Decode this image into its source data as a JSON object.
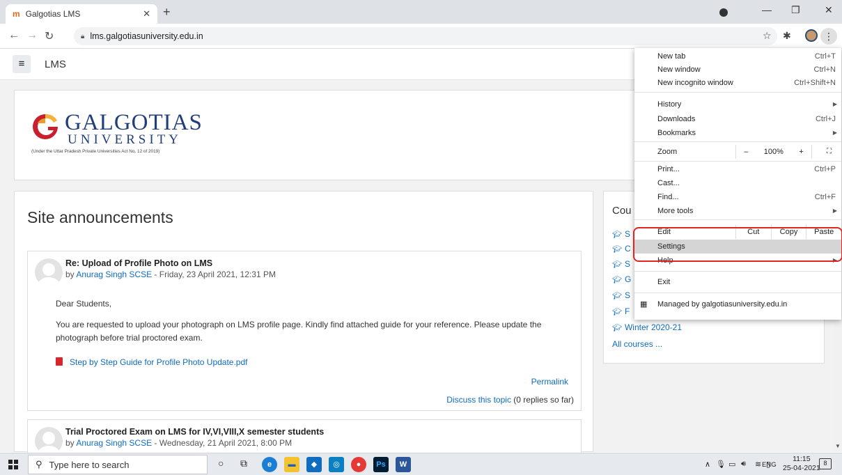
{
  "browser": {
    "tab_title": "Galgotias LMS",
    "tab_favicon": "m",
    "url": "lms.galgotiasuniversity.edu.in"
  },
  "page": {
    "brand": "LMS",
    "logo": {
      "name_line1": "GALGOTIAS",
      "name_line2": "UNIVERSITY",
      "tagline": "(Under the Uttar Pradesh Private Universities Act No. 12 of 2019)"
    },
    "site_announcements_title": "Site announcements",
    "posts": [
      {
        "subject": "Re: Upload of Profile Photo on LMS",
        "by_prefix": "by ",
        "author": "Anurag Singh SCSE",
        "date": " - Friday, 23 April 2021, 12:31 PM",
        "greeting": "Dear Students,",
        "body": "You are requested to upload your photograph on LMS profile page. Kindly find attached guide for your reference. Please update the photograph before trial proctored exam.",
        "attachment": "Step by Step Guide for Profile Photo Update.pdf",
        "permalink": "Permalink",
        "discuss": "Discuss this topic",
        "replies": "(0 replies so far)"
      },
      {
        "subject": "Trial Proctored Exam on LMS for IV,VI,VIII,X semester students",
        "by_prefix": "by ",
        "author": "Anurag Singh SCSE",
        "date": " - Wednesday, 21 April 2021, 8:00 PM"
      }
    ],
    "courses_block": {
      "title": "Cou",
      "items": [
        "S",
        "C",
        "S",
        "G",
        "S",
        "F",
        "Winter 2020-21"
      ],
      "all_courses": "All courses ..."
    }
  },
  "chrome_menu": {
    "items": [
      {
        "label": "New tab",
        "shortcut": "Ctrl+T"
      },
      {
        "label": "New window",
        "shortcut": "Ctrl+N"
      },
      {
        "label": "New incognito window",
        "shortcut": "Ctrl+Shift+N"
      },
      {
        "label": "History"
      },
      {
        "label": "Downloads",
        "shortcut": "Ctrl+J"
      },
      {
        "label": "Bookmarks"
      },
      {
        "label": "Zoom",
        "zoom_minus": "–",
        "zoom_value": "100%",
        "zoom_plus": "+"
      },
      {
        "label": "Print...",
        "shortcut": "Ctrl+P"
      },
      {
        "label": "Cast..."
      },
      {
        "label": "Find...",
        "shortcut": "Ctrl+F"
      },
      {
        "label": "More tools"
      },
      {
        "label": "Edit",
        "cut": "Cut",
        "copy": "Copy",
        "paste": "Paste"
      },
      {
        "label": "Settings"
      },
      {
        "label": "Help"
      },
      {
        "label": "Exit"
      },
      {
        "label": "Managed by galgotiasuniversity.edu.in"
      }
    ],
    "highlight_color": "#e02424"
  },
  "taskbar": {
    "search_placeholder": "Type here to search",
    "lang": "ENG",
    "time": "11:15",
    "date": "25-04-2021",
    "notifications": "8"
  }
}
